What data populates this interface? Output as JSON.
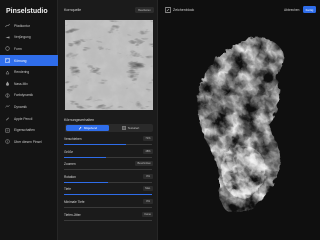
{
  "app": {
    "title": "Pinselstudio"
  },
  "sidebar": {
    "items": [
      {
        "label": "Pfadkontur",
        "icon": "stroke-path-icon",
        "active": false
      },
      {
        "label": "Verjüngung",
        "icon": "taper-icon",
        "active": false
      },
      {
        "label": "Form",
        "icon": "shape-icon",
        "active": false
      },
      {
        "label": "Körnung",
        "icon": "grain-icon",
        "active": true
      },
      {
        "label": "Rendering",
        "icon": "rendering-icon",
        "active": false
      },
      {
        "label": "Nass-Mix",
        "icon": "wet-mix-icon",
        "active": false
      },
      {
        "label": "Farbdynamik",
        "icon": "color-dynamics-icon",
        "active": false
      },
      {
        "label": "Dynamik",
        "icon": "dynamics-icon",
        "active": false
      },
      {
        "label": "Apple Pencil",
        "icon": "pencil-icon",
        "active": false
      },
      {
        "label": "Eigenschaften",
        "icon": "properties-icon",
        "active": false
      },
      {
        "label": "Über diesen Pinsel",
        "icon": "info-icon",
        "active": false
      }
    ]
  },
  "panel": {
    "title": "Kornquelle",
    "import_label": "Bearbeiten",
    "behavior_title": "Körnungsverhalten",
    "segments": [
      {
        "label": "Mitgehend",
        "active": true
      },
      {
        "label": "Texturiert",
        "active": false
      }
    ],
    "settings": [
      {
        "label": "Verschieben",
        "value": "71%",
        "fill": 0.71
      },
      {
        "label": "Größe",
        "value": "48%",
        "fill": 0.48
      },
      {
        "label": "Zoomen",
        "value": "Beschnitten",
        "fill": 0.0
      },
      {
        "label": "Rotation",
        "value": "0%",
        "fill": 0.5
      },
      {
        "label": "Tiefe",
        "value": "Max.",
        "fill": 1.0
      },
      {
        "label": "Minimale Tiefe",
        "value": "0%",
        "fill": 0.0
      },
      {
        "label": "Tiefen-Jitter",
        "value": "Keine",
        "fill": 0.0
      }
    ]
  },
  "drawpad": {
    "title": "Zeichenblock",
    "cancel_label": "Abbrechen",
    "done_label": "Fertig"
  },
  "colors": {
    "accent": "#2f6dea",
    "background": "#0f0f0f",
    "panel": "#1b1b1b"
  }
}
